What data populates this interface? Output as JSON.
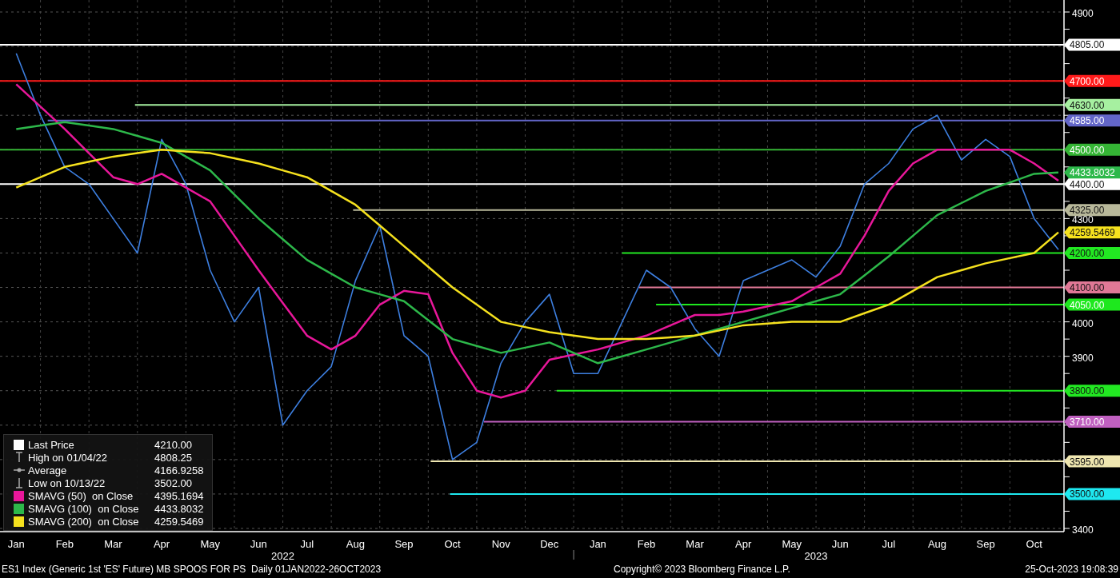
{
  "chart_data": {
    "type": "line",
    "grid": true,
    "ylim": [
      3400,
      4900
    ],
    "yticks": [
      3400,
      3900,
      4000,
      4300,
      4900
    ],
    "categories": [
      "Jan",
      null,
      "Feb",
      null,
      "Mar",
      null,
      "Apr",
      null,
      "May",
      null,
      "Jun",
      null,
      "Jul",
      null,
      "Aug",
      null,
      "Sep",
      null,
      "Oct",
      null,
      "Nov",
      null,
      "Dec",
      null,
      "Jan",
      null,
      "Feb",
      null,
      "Mar",
      null,
      "Apr",
      null,
      "May",
      null,
      "Jun",
      null,
      "Jul",
      null,
      "Aug",
      null,
      "Sep",
      null,
      "Oct",
      null
    ],
    "series": [
      {
        "color": "#3d7fe0",
        "values": [
          4780,
          4600,
          4450,
          4400,
          4300,
          4200,
          4530,
          4400,
          4150,
          4000,
          4100,
          3700,
          3800,
          3870,
          4120,
          4280,
          3960,
          3900,
          3600,
          3650,
          3880,
          4000,
          4080,
          3850,
          3850,
          4000,
          4150,
          4100,
          3980,
          3900,
          4120,
          4150,
          4180,
          4130,
          4220,
          4400,
          4460,
          4560,
          4600,
          4470,
          4530,
          4480,
          4300,
          4210
        ]
      },
      {
        "color": "#e8179a",
        "values": [
          4690,
          4625,
          4560,
          4490,
          4420,
          4400,
          4430,
          4390,
          4350,
          4250,
          4150,
          4055,
          3960,
          3920,
          3960,
          4050,
          4090,
          4080,
          3910,
          3800,
          3780,
          3800,
          3890,
          3905,
          3920,
          3940,
          3960,
          3990,
          4020,
          4020,
          4030,
          4045,
          4060,
          4100,
          4140,
          4250,
          4380,
          4460,
          4500,
          4500,
          4500,
          4500,
          4460,
          4410
        ]
      },
      {
        "color": "#2db84a",
        "values": [
          4560,
          4570,
          4580,
          4570,
          4560,
          4540,
          4520,
          4480,
          4440,
          4370,
          4300,
          4240,
          4180,
          4140,
          4100,
          4080,
          4060,
          4005,
          3950,
          3930,
          3910,
          3925,
          3940,
          3910,
          3880,
          3900,
          3920,
          3940,
          3960,
          3980,
          4000,
          4020,
          4040,
          4060,
          4080,
          4135,
          4190,
          4250,
          4310,
          4345,
          4380,
          4405,
          4430,
          4434
        ]
      },
      {
        "color": "#f5e11e",
        "values": [
          4390,
          4420,
          4450,
          4465,
          4480,
          4490,
          4500,
          4495,
          4490,
          4475,
          4460,
          4440,
          4420,
          4380,
          4340,
          4280,
          4220,
          4160,
          4100,
          4050,
          4000,
          3985,
          3970,
          3960,
          3950,
          3950,
          3950,
          3955,
          3960,
          3975,
          3990,
          3995,
          4000,
          4000,
          4000,
          4025,
          4050,
          4090,
          4130,
          4150,
          4170,
          4185,
          4200,
          4260
        ]
      }
    ],
    "ref_lines": [
      {
        "axis": "y",
        "value": 4805,
        "label": "4805.00",
        "color": "#ffffff"
      },
      {
        "axis": "y",
        "value": 4700,
        "label": "4700.00",
        "color": "#ff1a1a"
      },
      {
        "axis": "y",
        "value": 4630,
        "label": "4630.00",
        "color": "#a6f0a0"
      },
      {
        "axis": "y",
        "value": 4585,
        "label": "4585.00",
        "color": "#6366c8"
      },
      {
        "axis": "y",
        "value": 4500,
        "label": "4500.00",
        "color": "#35b535"
      },
      {
        "axis": "y",
        "value": 4400,
        "label": "4400.00",
        "color": "#ffffff"
      },
      {
        "axis": "y",
        "value": 4325,
        "label": "4325.00",
        "color": "#b8b89a"
      },
      {
        "axis": "y",
        "value": 4200,
        "label": "4200.00",
        "color": "#22e822"
      },
      {
        "axis": "y",
        "value": 4100,
        "label": "4100.00",
        "color": "#e07896"
      },
      {
        "axis": "y",
        "value": 4050,
        "label": "4050.00",
        "color": "#1ee81e"
      },
      {
        "axis": "y",
        "value": 3800,
        "label": "3800.00",
        "color": "#22e822"
      },
      {
        "axis": "y",
        "value": 3710,
        "label": "3710.00",
        "color": "#c060c0"
      },
      {
        "axis": "y",
        "value": 3595,
        "label": "3595.00",
        "color": "#efe6b0"
      },
      {
        "axis": "y",
        "value": 3500,
        "label": "3500.00",
        "color": "#1ee8f0"
      }
    ]
  },
  "years": [
    "2022",
    "2023"
  ],
  "series_tags": [
    "4433.8032",
    "4259.5469"
  ],
  "legend": [
    {
      "kind": "box",
      "label": "Last Price",
      "value": "4210.00",
      "color": "#ffffff"
    },
    {
      "kind": "high",
      "label": "High on 01/04/22",
      "value": "4808.25"
    },
    {
      "kind": "average",
      "label": "Average",
      "value": "4166.9258"
    },
    {
      "kind": "low",
      "label": "Low on 10/13/22",
      "value": "3502.00"
    },
    {
      "kind": "box",
      "label": "SMAVG (50)  on Close",
      "value": "4395.1694",
      "color": "#e8179a"
    },
    {
      "kind": "box",
      "label": "SMAVG (100)  on Close",
      "value": "4433.8032",
      "color": "#2db84a"
    },
    {
      "kind": "box",
      "label": "SMAVG (200)  on Close",
      "value": "4259.5469",
      "color": "#f5e11e"
    }
  ],
  "footer": {
    "description": "ES1 Index (Generic 1st 'ES' Future) MB SPOOS FOR PS  Daily 01JAN2022-26OCT2023",
    "copyright": "Copyright© 2023 Bloomberg Finance L.P.",
    "timestamp": "25-Oct-2023 19:08:39"
  }
}
